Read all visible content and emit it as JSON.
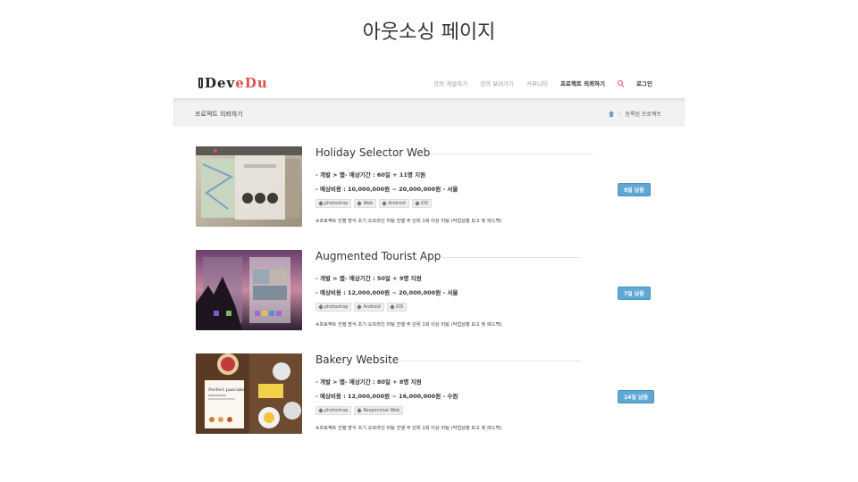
{
  "slide": {
    "title": "아웃소싱 페이지"
  },
  "brand": {
    "logo_part1": "Dev",
    "logo_part2": "eDu"
  },
  "nav": {
    "items": [
      "강의 개설하기",
      "강의 보러가기",
      "커뮤니티",
      "프로젝트 의뢰하기"
    ],
    "active_index": 3,
    "search_icon": "search-icon",
    "login": "로그인"
  },
  "subheader": {
    "page_name": "프로젝트 의뢰하기",
    "breadcrumb_home_icon": "home-icon",
    "breadcrumb_sep": "/",
    "breadcrumb_current": "등록된 프로젝트"
  },
  "projects": [
    {
      "title": "Holiday Selector Web",
      "meta1": "- 개발 > 앱- 예상기간 : 60일 + 11명 지원",
      "meta2": "- 예상비용 : 10,000,000원 ~ 20,000,000원 - 서울",
      "tags": [
        "photoshop",
        "Web",
        "Android",
        "iOS"
      ],
      "note": "※프로젝트 진행 방식 초기 오프라인 미팅 진행 주 단위 1회 이상 미팅 (작업상황 보고 및 피드백)",
      "badge": "9일 남음"
    },
    {
      "title": "Augmented Tourist App",
      "meta1": "- 개발 > 앱- 예상기간 : 50일 + 9명 지원",
      "meta2": "- 예상비용 : 12,000,000원 ~ 20,000,000원 - 서울",
      "tags": [
        "photoshop",
        "Android",
        "iOS"
      ],
      "note": "※프로젝트 진행 방식 초기 오프라인 미팅 진행 주 단위 1회 이상 미팅 (작업상황 보고 및 피드백)",
      "badge": "7일 남음"
    },
    {
      "title": "Bakery Website",
      "meta1": "- 개발 > 앱- 예상기간 : 80일 + 8명 지원",
      "meta2": "- 예상비용 : 12,000,000원 ~ 16,000,000원 - 수원",
      "tags": [
        "photoshop",
        "Responsive Web"
      ],
      "note": "※프로젝트 진행 방식 초기 오프라인 미팅 진행 주 단위 1회 이상 미팅 (작업상황 보고 및 피드백)",
      "badge": "14일 남음",
      "thumb_caption": "Perfect pancakes"
    }
  ],
  "colors": {
    "accent": "#d9534f",
    "badge": "#5fa8d3",
    "subheader_bg": "#f2f2f2"
  }
}
